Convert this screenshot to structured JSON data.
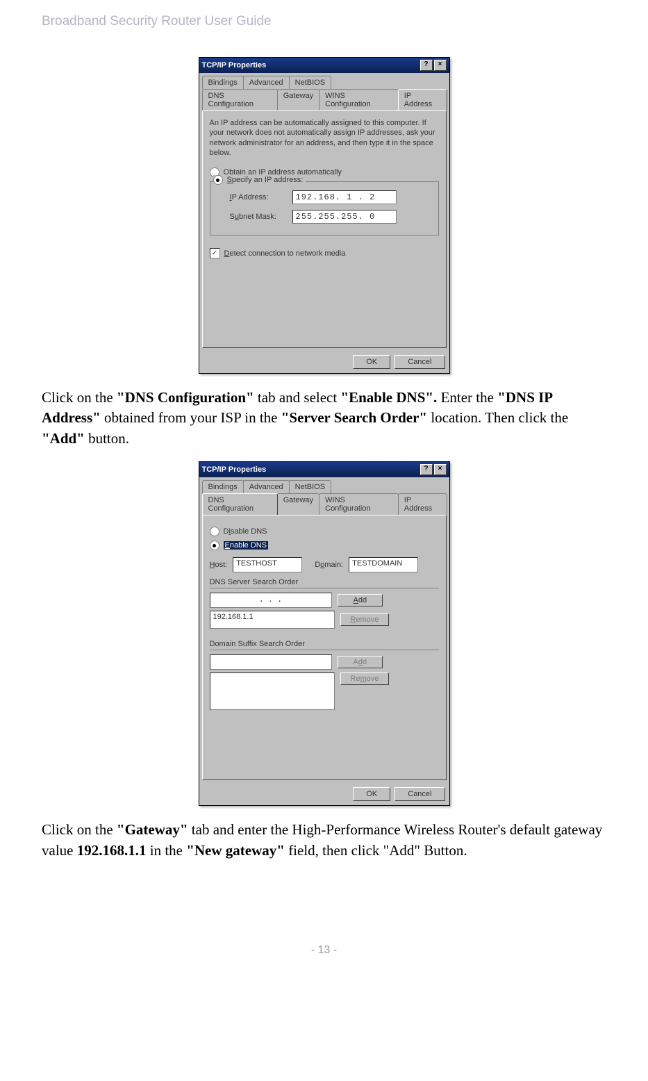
{
  "header": {
    "title": "Broadband Security Router User Guide"
  },
  "dialog1": {
    "title": "TCP/IP Properties",
    "tabs_row1": [
      "Bindings",
      "Advanced",
      "NetBIOS"
    ],
    "tabs_row2": [
      "DNS Configuration",
      "Gateway",
      "WINS Configuration",
      "IP Address"
    ],
    "active_tab": "IP Address",
    "desc": "An IP address can be automatically assigned to this computer. If your network does not automatically assign IP addresses, ask your network administrator for an address, and then type it in the space below.",
    "radio_auto": "Obtain an IP address automatically",
    "radio_spec": "Specify an IP address:",
    "ip_label": "IP Address:",
    "ip_value": "192.168. 1 . 2",
    "mask_label": "Subnet Mask:",
    "mask_value": "255.255.255. 0",
    "detect": "Detect connection to network media",
    "ok": "OK",
    "cancel": "Cancel"
  },
  "para1": {
    "t1": "Click on the ",
    "b1": "\"DNS Configuration\"",
    "t2": " tab and select ",
    "b2": "\"Enable DNS\".",
    "t3": " Enter the ",
    "b3": "\"DNS IP Address\"",
    "t4": " obtained from your ISP in the ",
    "b4": "\"Server Search Order\"",
    "t5": " location. Then click the ",
    "b5": "\"Add\"",
    "t6": " button."
  },
  "dialog2": {
    "title": "TCP/IP Properties",
    "tabs_row1": [
      "Bindings",
      "Advanced",
      "NetBIOS"
    ],
    "tabs_row2": [
      "DNS Configuration",
      "Gateway",
      "WINS Configuration",
      "IP Address"
    ],
    "active_tab": "DNS Configuration",
    "radio_disable": "Disable DNS",
    "radio_enable": "Enable DNS",
    "host_label": "Host:",
    "host_value": "TESTHOST",
    "domain_label": "Domain:",
    "domain_value": "TESTDOMAIN",
    "server_order": "DNS Server Search Order",
    "server_ip_empty": ".    .    .",
    "server_list_item": "192.168.1.1",
    "suffix_order": "Domain Suffix Search Order",
    "add": "Add",
    "remove": "Remove",
    "ok": "OK",
    "cancel": "Cancel"
  },
  "para2": {
    "t1": "Click on the ",
    "b1": "\"Gateway\"",
    "t2": " tab and enter the High-Performance Wireless Router's default gateway value ",
    "b2": "192.168.1.1",
    "t3": " in the ",
    "b3": "\"New gateway\"",
    "t4": " field, then click \"Add\" Button."
  },
  "footer": {
    "page": "- 13 -"
  }
}
